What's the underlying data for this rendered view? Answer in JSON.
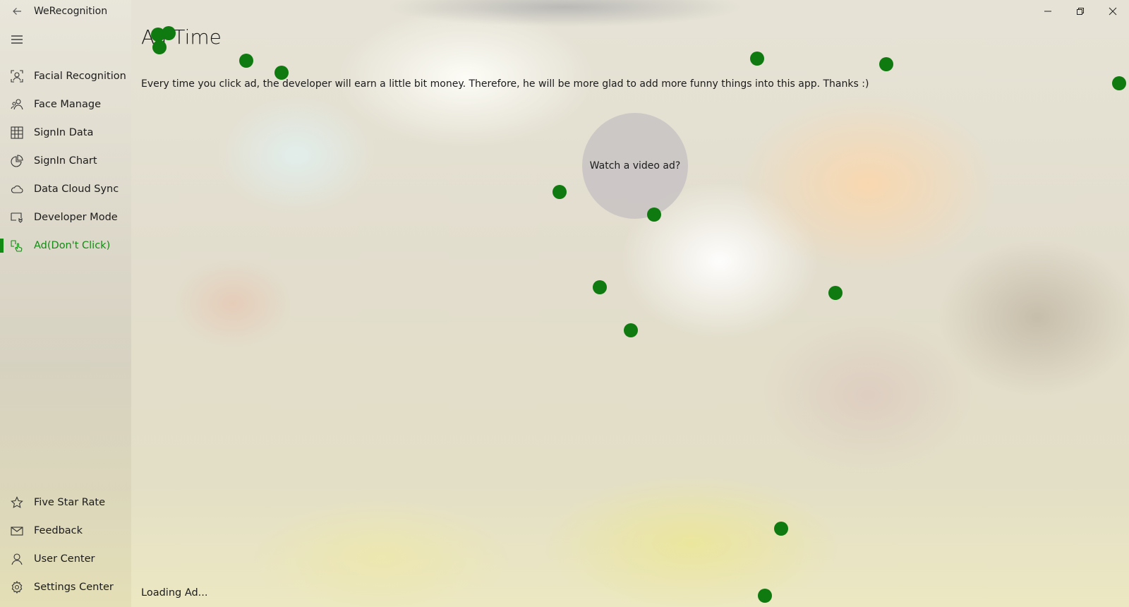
{
  "window": {
    "title": "WeRecognition",
    "controls": [
      "minimize",
      "restore",
      "close"
    ]
  },
  "nav": {
    "top_items": [
      {
        "label": "Facial Recognition",
        "icon": "face-scan-icon"
      },
      {
        "label": "Face Manage",
        "icon": "people-icon"
      },
      {
        "label": "SignIn Data",
        "icon": "grid-table-icon"
      },
      {
        "label": "SignIn Chart",
        "icon": "pie-chart-icon"
      },
      {
        "label": "Data Cloud Sync",
        "icon": "cloud-icon"
      },
      {
        "label": "Developer Mode",
        "icon": "developer-icon"
      },
      {
        "label": "Ad(Don't Click)",
        "icon": "hand-pointer-icon",
        "selected": true
      }
    ],
    "bottom_items": [
      {
        "label": "Five Star Rate",
        "icon": "star-icon"
      },
      {
        "label": "Feedback",
        "icon": "mail-icon"
      },
      {
        "label": "User Center",
        "icon": "user-icon"
      },
      {
        "label": "Settings Center",
        "icon": "gear-icon"
      }
    ]
  },
  "main": {
    "title": "Ad Time",
    "description": "Every time you click ad, the developer will earn a little bit money. Therefore, he will be more glad to add more funny things into this app. Thanks :)",
    "ad_button": "Watch a video ad?",
    "status": "Loading Ad..."
  },
  "colors": {
    "accent": "#138a13",
    "dot": "#0f7a0f",
    "ad_circle": "#c8c4c4"
  }
}
